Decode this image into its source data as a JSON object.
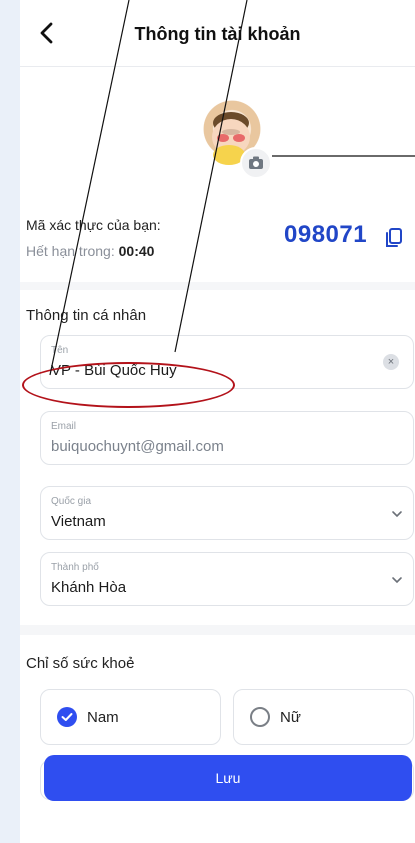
{
  "header": {
    "title": "Thông tin tài khoản"
  },
  "account": {
    "code_label": "Mã xác thực của bạn:",
    "expire_label": "Hết hạn trong:",
    "expire_time": "00:40",
    "code_value": "098071"
  },
  "personal": {
    "section_title": "Thông tin cá nhân",
    "name_label": "Tên",
    "name_value": "VP - Bùi Quốc Huy",
    "email_label": "Email",
    "email_value": "buiquochuynt@gmail.com",
    "country_label": "Quốc gia",
    "country_value": "Vietnam",
    "city_label": "Thành phố",
    "city_value": "Khánh Hòa"
  },
  "health": {
    "section_title": "Chỉ số sức khoẻ",
    "male": "Nam",
    "female": "Nữ",
    "selected": "Nam"
  },
  "actions": {
    "save": "Lưu"
  },
  "colors": {
    "accent": "#2f4ef0",
    "code": "#2146c7",
    "annotation": "#b3121a"
  },
  "icons": [
    "back-arrow-icon",
    "camera-icon",
    "copy-icon",
    "clear-icon",
    "chevron-down-icon"
  ]
}
